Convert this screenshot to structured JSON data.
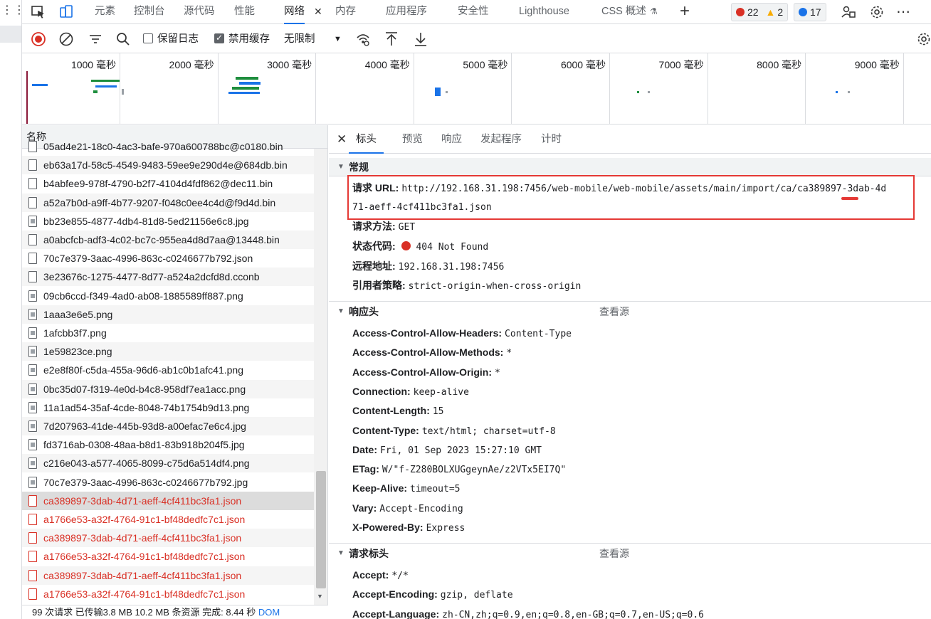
{
  "top_tabs": [
    "元素",
    "控制台",
    "源代码",
    "性能",
    "网络",
    "内存",
    "应用程序",
    "安全性",
    "Lighthouse",
    "CSS 概述"
  ],
  "active_tab_index": 4,
  "badges": {
    "errors": "22",
    "warnings": "2",
    "info": "17"
  },
  "toolbar": {
    "preserve_log_label": "保留日志",
    "disable_cache_label": "禁用缓存",
    "throttle_value": "无限制"
  },
  "overview_ticks": [
    "1000 毫秒",
    "2000 毫秒",
    "3000 毫秒",
    "4000 毫秒",
    "5000 毫秒",
    "6000 毫秒",
    "7000 毫秒",
    "8000 毫秒",
    "9000 毫秒"
  ],
  "list": {
    "header": "名称",
    "rows": [
      {
        "name": "05ad4e21-18c0-4ac3-bafe-970a600788bc@c0180.bin",
        "type": "file",
        "error": false
      },
      {
        "name": "eb63a17d-58c5-4549-9483-59ee9e290d4e@684db.bin",
        "type": "file",
        "error": false
      },
      {
        "name": "b4abfee9-978f-4790-b2f7-4104d4fdf862@dec11.bin",
        "type": "file",
        "error": false
      },
      {
        "name": "a52a7b0d-a9ff-4b77-9207-f048c0ee4c4d@f9d4d.bin",
        "type": "file",
        "error": false
      },
      {
        "name": "bb23e855-4877-4db4-81d8-5ed21156e6c8.jpg",
        "type": "img",
        "error": false
      },
      {
        "name": "a0abcfcb-adf3-4c02-bc7c-955ea4d8d7aa@13448.bin",
        "type": "file",
        "error": false
      },
      {
        "name": "70c7e379-3aac-4996-863c-c0246677b792.json",
        "type": "file",
        "error": false
      },
      {
        "name": "3e23676c-1275-4477-8d77-a524a2dcfd8d.cconb",
        "type": "file",
        "error": false
      },
      {
        "name": "09cb6ccd-f349-4ad0-ab08-1885589ff887.png",
        "type": "img",
        "error": false
      },
      {
        "name": "1aaa3e6e5.png",
        "type": "img",
        "error": false
      },
      {
        "name": "1afcbb3f7.png",
        "type": "img",
        "error": false
      },
      {
        "name": "1e59823ce.png",
        "type": "img",
        "error": false
      },
      {
        "name": "e2e8f80f-c5da-455a-96d6-ab1c0b1afc41.png",
        "type": "img",
        "error": false
      },
      {
        "name": "0bc35d07-f319-4e0d-b4c8-958df7ea1acc.png",
        "type": "img",
        "error": false
      },
      {
        "name": "11a1ad54-35af-4cde-8048-74b1754b9d13.png",
        "type": "img",
        "error": false
      },
      {
        "name": "7d207963-41de-445b-93d8-a00efac7e6c4.jpg",
        "type": "img",
        "error": false
      },
      {
        "name": "fd3716ab-0308-48aa-b8d1-83b918b204f5.jpg",
        "type": "img",
        "error": false
      },
      {
        "name": "c216e043-a577-4065-8099-c75d6a514df4.png",
        "type": "img",
        "error": false
      },
      {
        "name": "70c7e379-3aac-4996-863c-c0246677b792.jpg",
        "type": "img",
        "error": false
      },
      {
        "name": "ca389897-3dab-4d71-aeff-4cf411bc3fa1.json",
        "type": "file",
        "error": true
      },
      {
        "name": "a1766e53-a32f-4764-91c1-bf48dedfc7c1.json",
        "type": "file",
        "error": true
      },
      {
        "name": "ca389897-3dab-4d71-aeff-4cf411bc3fa1.json",
        "type": "file",
        "error": true
      },
      {
        "name": "a1766e53-a32f-4764-91c1-bf48dedfc7c1.json",
        "type": "file",
        "error": true
      },
      {
        "name": "ca389897-3dab-4d71-aeff-4cf411bc3fa1.json",
        "type": "file",
        "error": true
      },
      {
        "name": "a1766e53-a32f-4764-91c1-bf48dedfc7c1.json",
        "type": "file",
        "error": true
      }
    ],
    "selected_index": 19
  },
  "statusbar": {
    "text": "99 次请求  已传输3.8 MB  10.2 MB 条资源  完成: 8.44 秒",
    "link": "DOM"
  },
  "detail": {
    "tabs": [
      "标头",
      "预览",
      "响应",
      "发起程序",
      "计时"
    ],
    "active_tab_index": 0,
    "general": {
      "title": "常规",
      "url_label": "请求 URL:",
      "url_line1": "http://192.168.31.198:7456/web-mobile/web-mobile/assets/main/import/ca/ca389897-3dab-4d",
      "url_line2": "71-aeff-4cf411bc3fa1.json",
      "method_label": "请求方法:",
      "method": "GET",
      "status_label": "状态代码:",
      "status": "404 Not Found",
      "remote_label": "远程地址:",
      "remote": "192.168.31.198:7456",
      "referrer_label": "引用者策略:",
      "referrer": "strict-origin-when-cross-origin"
    },
    "response_headers": {
      "title": "响应头",
      "view_source": "查看源",
      "items": [
        {
          "k": "Access-Control-Allow-Headers:",
          "v": "Content-Type"
        },
        {
          "k": "Access-Control-Allow-Methods:",
          "v": "*"
        },
        {
          "k": "Access-Control-Allow-Origin:",
          "v": "*"
        },
        {
          "k": "Connection:",
          "v": "keep-alive"
        },
        {
          "k": "Content-Length:",
          "v": "15"
        },
        {
          "k": "Content-Type:",
          "v": "text/html; charset=utf-8"
        },
        {
          "k": "Date:",
          "v": "Fri, 01 Sep 2023 15:27:10 GMT"
        },
        {
          "k": "ETag:",
          "v": "W/\"f-Z280BOLXUGgeynAe/z2VTx5EI7Q\""
        },
        {
          "k": "Keep-Alive:",
          "v": "timeout=5"
        },
        {
          "k": "Vary:",
          "v": "Accept-Encoding"
        },
        {
          "k": "X-Powered-By:",
          "v": "Express"
        }
      ]
    },
    "request_headers": {
      "title": "请求标头",
      "view_source": "查看源",
      "items": [
        {
          "k": "Accept:",
          "v": "*/*"
        },
        {
          "k": "Accept-Encoding:",
          "v": "gzip, deflate"
        },
        {
          "k": "Accept-Language:",
          "v": "zh-CN,zh;q=0.9,en;q=0.8,en-GB;q=0.7,en-US;q=0.6"
        }
      ]
    }
  },
  "colors": {
    "accent": "#1a73e8",
    "error": "#d93025",
    "highlight_box": "#e53935"
  }
}
